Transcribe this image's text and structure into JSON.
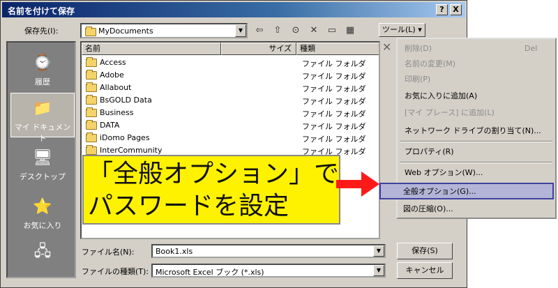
{
  "window": {
    "title": "名前を付けて保存",
    "help_btn": "?",
    "close_btn": "X"
  },
  "header": {
    "save_in_label": "保存先(I):",
    "save_in_value": "MyDocuments",
    "tools_label": "ツール(L) ▾"
  },
  "places": [
    {
      "label": "履歴",
      "icon": "history-icon",
      "glyph": "⌚"
    },
    {
      "label": "マイ ドキュメント",
      "icon": "my-documents-icon",
      "glyph": "📁"
    },
    {
      "label": "デスクトップ",
      "icon": "desktop-icon",
      "glyph": "🖥"
    },
    {
      "label": "お気に入り",
      "icon": "favorites-icon",
      "glyph": "⭐"
    },
    {
      "label": "",
      "icon": "network-icon",
      "glyph": "🖧"
    }
  ],
  "columns": {
    "name": "名前",
    "size": "サイズ",
    "type": "種類"
  },
  "files": [
    {
      "name": "Access",
      "type": "ファイル フォルダ"
    },
    {
      "name": "Adobe",
      "type": "ファイル フォルダ"
    },
    {
      "name": "Allabout",
      "type": "ファイル フォルダ"
    },
    {
      "name": "BsGOLD Data",
      "type": "ファイル フォルダ"
    },
    {
      "name": "Business",
      "type": "ファイル フォルダ"
    },
    {
      "name": "DATA",
      "type": "ファイル フォルダ"
    },
    {
      "name": "iDomo Pages",
      "type": "ファイル フォルダ"
    },
    {
      "name": "InterCommunity",
      "type": "ファイル フォルダ"
    }
  ],
  "menu": [
    {
      "label": "削除(D)",
      "shortcut": "Del",
      "disabled": true
    },
    {
      "label": "名前の変更(M)",
      "disabled": true
    },
    {
      "label": "印刷(P)",
      "disabled": true
    },
    {
      "label": "お気に入りに追加(A)",
      "disabled": false
    },
    {
      "label": "[マイ プレース] に追加(L)",
      "disabled": true
    },
    {
      "label": "ネットワーク ドライブの割り当て(N)...",
      "disabled": false
    },
    {
      "label": "プロパティ(R)",
      "disabled": false
    },
    {
      "label": "Web オプション(W)...",
      "disabled": false
    },
    {
      "label": "全般オプション(G)...",
      "disabled": false,
      "highlighted": true
    },
    {
      "label": "図の圧縮(O)...",
      "disabled": false
    }
  ],
  "bottom": {
    "filename_label": "ファイル名(N):",
    "filename_value": "Book1.xls",
    "filetype_label": "ファイルの種類(T):",
    "filetype_value": "Microsoft Excel ブック (*.xls)",
    "save_button": "保存(S)",
    "cancel_button": "キャンセル"
  },
  "callout": {
    "line1": "「全般オプション」で",
    "line2": "パスワードを設定"
  },
  "colors": {
    "callout_bg": "#fff200",
    "arrow": "#ff1a1a",
    "highlight": "#b4b4d8"
  }
}
